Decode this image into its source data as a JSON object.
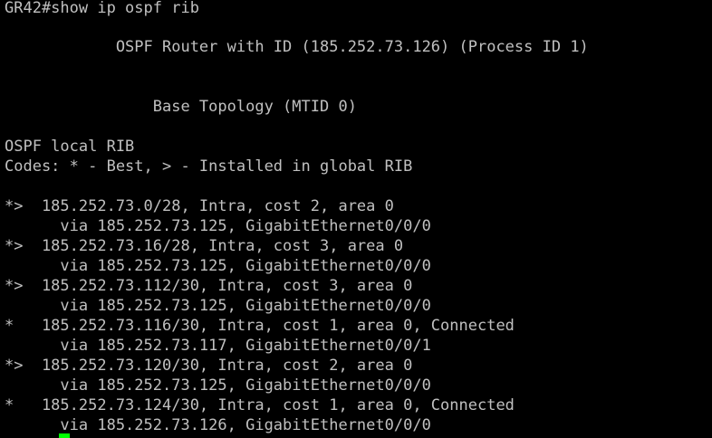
{
  "colors": {
    "background": "#000000",
    "text": "#c0c0c0",
    "cursor": "#00ff00"
  },
  "terminal": {
    "lines": [
      "GR42#show ip ospf rib",
      "",
      "            OSPF Router with ID (185.252.73.126) (Process ID 1)",
      "",
      "",
      "                Base Topology (MTID 0)",
      "",
      "OSPF local RIB",
      "Codes: * - Best, > - Installed in global RIB",
      "",
      "*>  185.252.73.0/28, Intra, cost 2, area 0",
      "      via 185.252.73.125, GigabitEthernet0/0/0",
      "*>  185.252.73.16/28, Intra, cost 3, area 0",
      "      via 185.252.73.125, GigabitEthernet0/0/0",
      "*>  185.252.73.112/30, Intra, cost 3, area 0",
      "      via 185.252.73.125, GigabitEthernet0/0/0",
      "*   185.252.73.116/30, Intra, cost 1, area 0, Connected",
      "      via 185.252.73.117, GigabitEthernet0/0/1",
      "*>  185.252.73.120/30, Intra, cost 2, area 0",
      "      via 185.252.73.125, GigabitEthernet0/0/0",
      "*   185.252.73.124/30, Intra, cost 1, area 0, Connected",
      "      via 185.252.73.126, GigabitEthernet0/0/0"
    ]
  }
}
